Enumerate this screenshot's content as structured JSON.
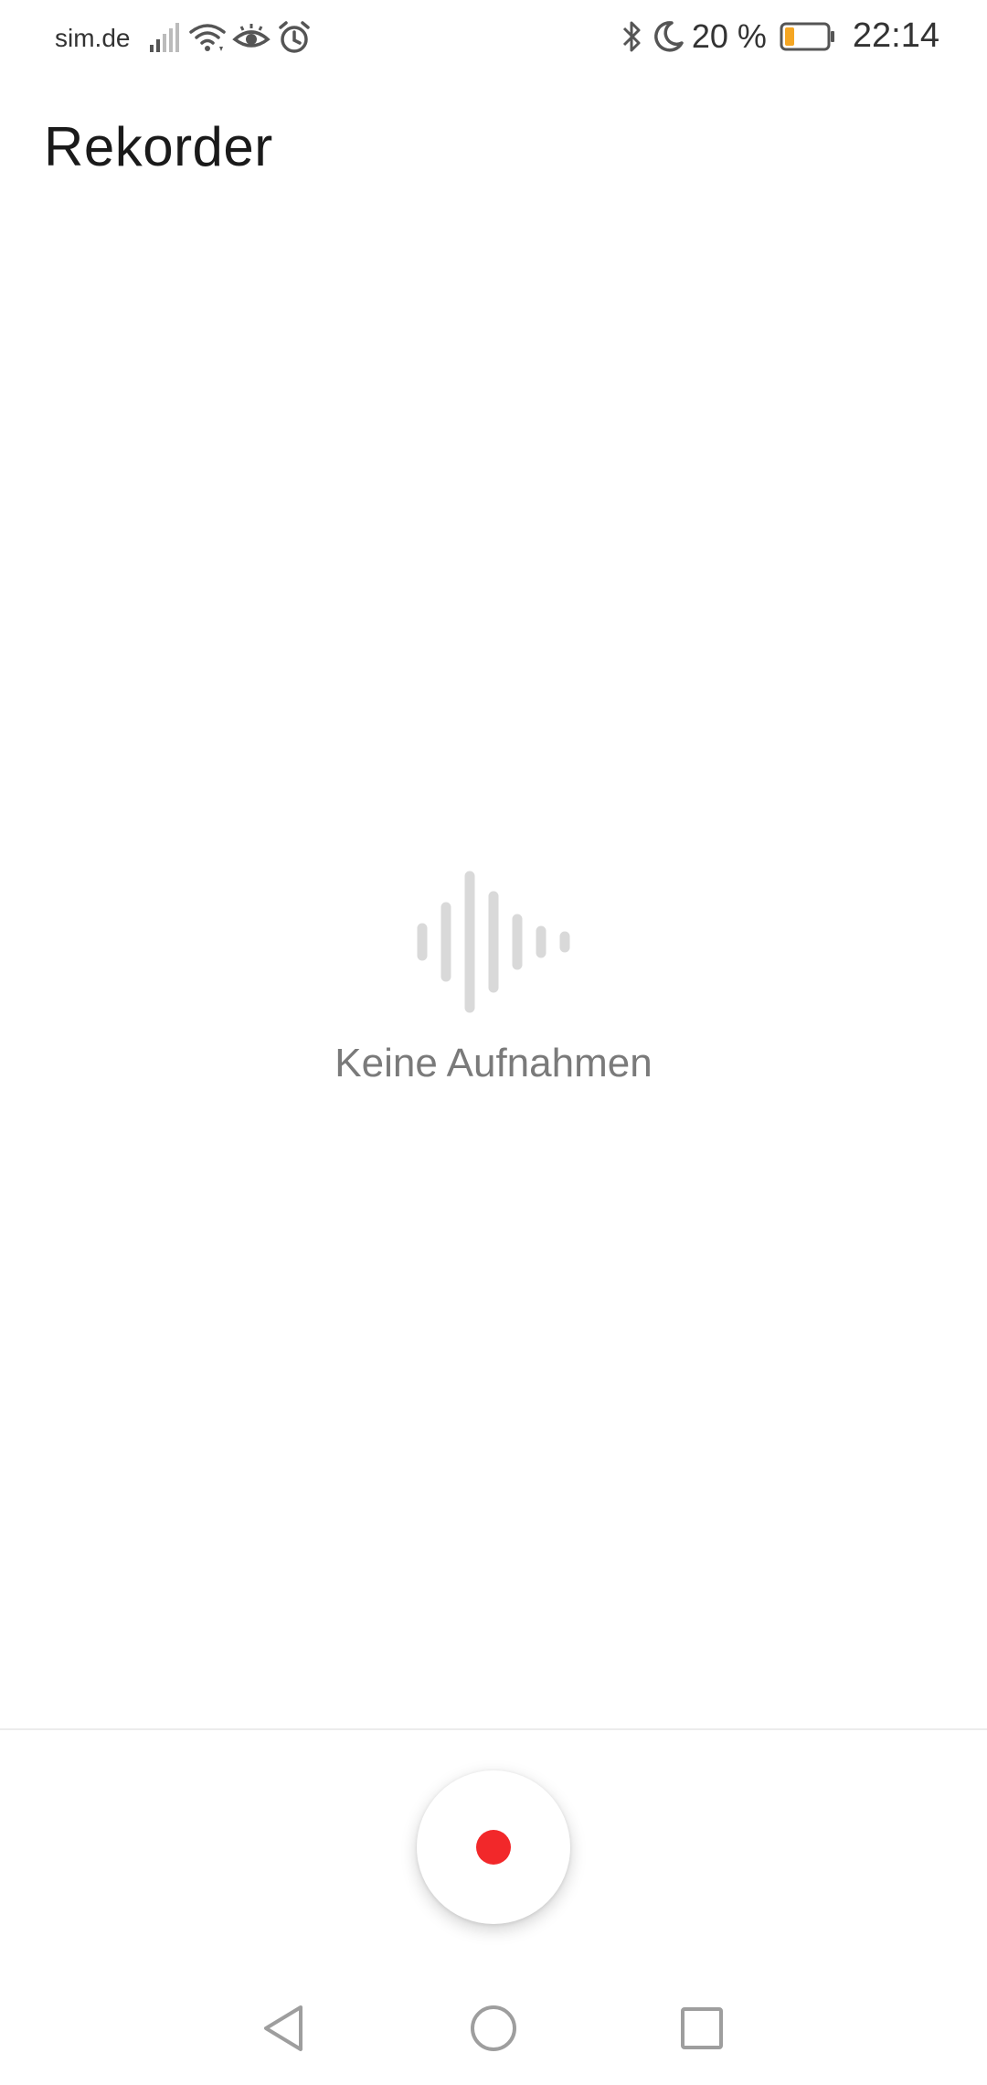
{
  "status_bar": {
    "carrier": "sim.de",
    "battery_percent": "20 %",
    "time": "22:14",
    "icons": [
      "signal-icon",
      "wifi-icon",
      "eye-comfort-icon",
      "alarm-icon",
      "bluetooth-icon",
      "moon-icon",
      "battery-icon"
    ]
  },
  "header": {
    "title": "Rekorder"
  },
  "empty_state": {
    "icon": "waveform-icon",
    "message": "Keine Aufnahmen"
  },
  "record": {
    "icon": "record-icon"
  },
  "nav": {
    "icons": [
      "back-icon",
      "home-icon",
      "recent-apps-icon"
    ]
  },
  "colors": {
    "record_red": "#f2282a",
    "waveform_gray": "#d9d9d9",
    "battery_orange": "#f5a623",
    "text_gray": "#7a7a7a",
    "nav_gray": "#9e9e9e"
  }
}
